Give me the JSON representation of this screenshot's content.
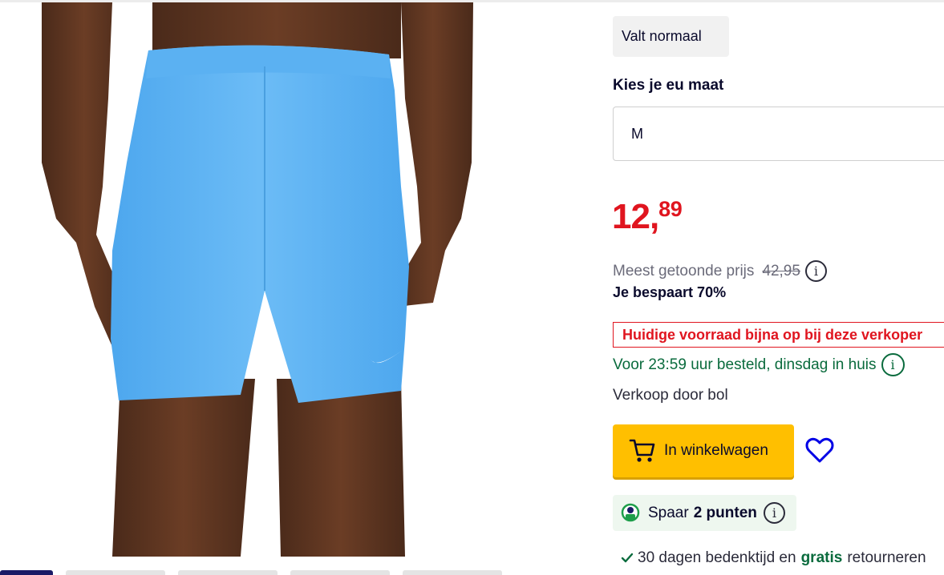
{
  "product": {
    "image_alt": "Blauwe zwemshort met wit logo",
    "fit_label": "Valt normaal",
    "size_label": "Kies je eu maat",
    "size_value": "M"
  },
  "pricing": {
    "price_int": "12,",
    "price_frac": "89",
    "reference_label": "Meest getoonde prijs",
    "reference_price": "42,95",
    "savings": "Je bespaart 70%"
  },
  "availability": {
    "stock_warning": "Huidige voorraad bijna op bij deze verkoper",
    "delivery": "Voor 23:59 uur besteld, dinsdag in huis",
    "seller": "Verkoop door bol"
  },
  "actions": {
    "cart_label": "In winkelwagen"
  },
  "points": {
    "prefix": "Spaar",
    "amount": "2 punten"
  },
  "returns": {
    "before": "30 dagen bedenktijd en",
    "highlight": "gratis",
    "after": "retourneren"
  },
  "icons": {
    "info": "info-icon",
    "cart": "cart-icon",
    "wishlist": "heart-icon",
    "points": "points-icon",
    "check": "check-icon"
  },
  "colors": {
    "price": "#e0151f",
    "cart_button": "#ffbf00",
    "delivery_green": "#0a6b3d",
    "wishlist_blue": "#0000e6"
  },
  "info_glyph": "i"
}
